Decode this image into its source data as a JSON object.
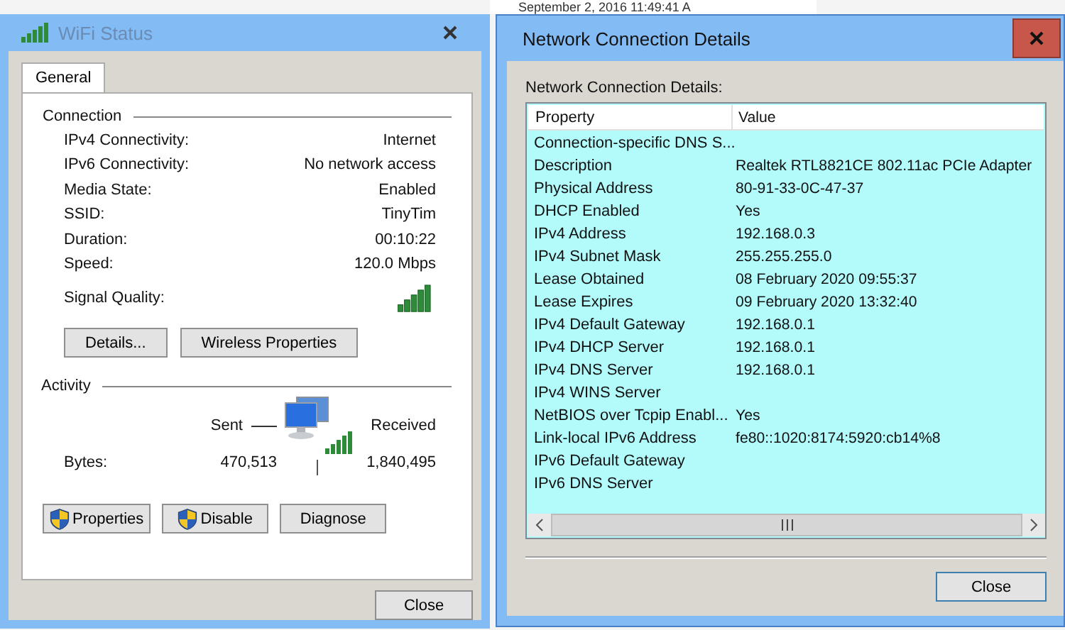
{
  "background": {
    "text": "September 2, 2016 11:49:41 A"
  },
  "wifi_status": {
    "title": "WiFi Status",
    "tabs": [
      {
        "label": "General",
        "selected": true
      }
    ],
    "connection": {
      "heading": "Connection",
      "rows": [
        {
          "label": "IPv4 Connectivity:",
          "value": "Internet"
        },
        {
          "label": "IPv6 Connectivity:",
          "value": "No network access"
        },
        {
          "label": "Media State:",
          "value": "Enabled"
        },
        {
          "label": "SSID:",
          "value": "TinyTim"
        },
        {
          "label": "Duration:",
          "value": "00:10:22"
        },
        {
          "label": "Speed:",
          "value": "120.0 Mbps"
        }
      ],
      "signal_label": "Signal Quality:"
    },
    "buttons": [
      "Details...",
      "Wireless Properties"
    ],
    "activity": {
      "heading": "Activity",
      "sent_label": "Sent",
      "received_label": "Received",
      "bytes_label": "Bytes:",
      "sent": "470,513",
      "received": "1,840,495"
    },
    "action_buttons": [
      {
        "label": "Properties",
        "shield": true
      },
      {
        "label": "Disable",
        "shield": true
      },
      {
        "label": "Diagnose",
        "shield": false
      }
    ],
    "close": "Close"
  },
  "details": {
    "title": "Network Connection Details",
    "label": "Network Connection Details:",
    "columns": [
      "Property",
      "Value"
    ],
    "rows": [
      {
        "property": "Connection-specific DNS S...",
        "value": ""
      },
      {
        "property": "Description",
        "value": "Realtek RTL8821CE 802.11ac PCIe Adapter"
      },
      {
        "property": "Physical Address",
        "value": "80-91-33-0C-47-37"
      },
      {
        "property": "DHCP Enabled",
        "value": "Yes"
      },
      {
        "property": "IPv4 Address",
        "value": "192.168.0.3"
      },
      {
        "property": "IPv4 Subnet Mask",
        "value": "255.255.255.0"
      },
      {
        "property": "Lease Obtained",
        "value": "08 February 2020 09:55:37"
      },
      {
        "property": "Lease Expires",
        "value": "09 February 2020 13:32:40"
      },
      {
        "property": "IPv4 Default Gateway",
        "value": "192.168.0.1"
      },
      {
        "property": "IPv4 DHCP Server",
        "value": "192.168.0.1"
      },
      {
        "property": "IPv4 DNS Server",
        "value": "192.168.0.1"
      },
      {
        "property": "IPv4 WINS Server",
        "value": ""
      },
      {
        "property": "NetBIOS over Tcpip Enabl...",
        "value": "Yes"
      },
      {
        "property": "Link-local IPv6 Address",
        "value": "fe80::1020:8174:5920:cb14%8"
      },
      {
        "property": "IPv6 Default Gateway",
        "value": ""
      },
      {
        "property": "IPv6 DNS Server",
        "value": ""
      }
    ],
    "close": "Close"
  }
}
